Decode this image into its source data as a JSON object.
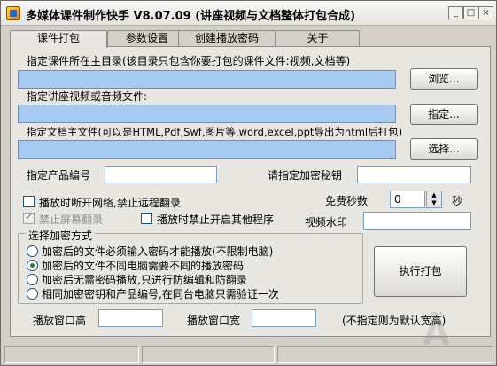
{
  "window": {
    "title": "多媒体课件制作快手  V8.07.09  (讲座视频与文档整体打包合成)",
    "controls": {
      "minimize": "_",
      "maximize": "□",
      "close": "×"
    }
  },
  "tabs": [
    {
      "label": "课件打包",
      "active": true
    },
    {
      "label": "参数设置",
      "active": false
    },
    {
      "label": "创建播放密码",
      "active": false
    },
    {
      "label": "关于",
      "active": false
    }
  ],
  "main": {
    "dir_label": "指定课件所在主目录(该目录只包含你要打包的课件文件:视频,文档等)",
    "dir_value": "",
    "browse_label": "浏览...",
    "video_label": "指定讲座视频或音频文件:",
    "video_value": "",
    "specify_label": "指定...",
    "doc_label": "指定文档主文件(可以是HTML,Pdf,Swf,图片等,word,excel,ppt导出为html后打包)",
    "doc_value": "",
    "select_label": "选择...",
    "product_label": "指定产品编号",
    "product_value": "",
    "key_label": "请指定加密秘钥",
    "key_value": "",
    "opt_disconnect": {
      "label": "播放时断开网络,禁止远程翻录",
      "checked": false
    },
    "opt_screen": {
      "label": "禁止屏幕翻录",
      "checked": true,
      "disabled": true
    },
    "opt_other_apps": {
      "label": "播放时禁止开启其他程序",
      "checked": false
    },
    "free_seconds_label": "免费秒数",
    "free_seconds_value": "0",
    "seconds_unit": "秒",
    "watermark_label": "视频水印",
    "watermark_value": "",
    "enc_group_label": "选择加密方式",
    "enc_options": [
      {
        "label": "加密后的文件必须输入密码才能播放(不限制电脑)",
        "selected": false
      },
      {
        "label": "加密后的文件不同电脑需要不同的播放密码",
        "selected": true
      },
      {
        "label": "加密后无需密码播放,只进行防编辑和防翻录",
        "selected": false
      },
      {
        "label": "相同加密密钥和产品编号,在同台电脑只需验证一次",
        "selected": false
      }
    ],
    "exec_label": "执行打包",
    "height_label": "播放窗口高",
    "height_value": "",
    "width_label": "播放窗口宽",
    "width_value": "",
    "default_note": "(不指定则为默认宽高)"
  },
  "watermark_logo": "Ã"
}
